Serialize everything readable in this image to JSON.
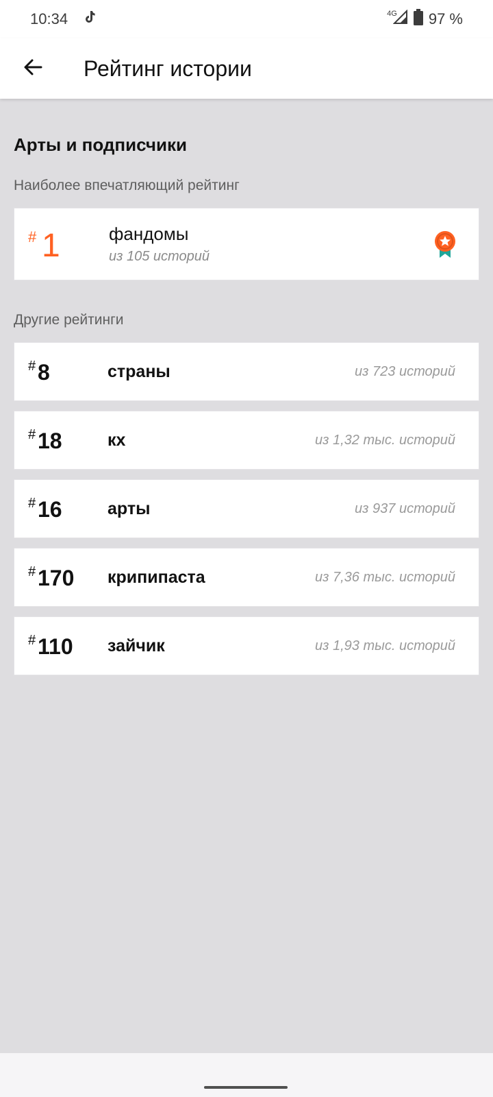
{
  "status_bar": {
    "time": "10:34",
    "network": "4G",
    "battery": "97 %",
    "icons": [
      "tiktok-icon",
      "signal-icon",
      "battery-icon"
    ]
  },
  "app_bar": {
    "title": "Рейтинг истории",
    "back_icon": "arrow-left-icon"
  },
  "section": {
    "title": "Арты и подписчики",
    "top_heading": "Наиболее впечатляющий рейтинг",
    "others_heading": "Другие рейтинги"
  },
  "top_rank": {
    "hash": "#",
    "rank": "1",
    "tag": "фандомы",
    "of": "из 105 историй",
    "badge_icon": "award-ribbon-icon"
  },
  "other_ranks": [
    {
      "hash": "#",
      "rank": "8",
      "tag": "страны",
      "of": "из 723 историй"
    },
    {
      "hash": "#",
      "rank": "18",
      "tag": "кх",
      "of": "из 1,32 тыс. историй"
    },
    {
      "hash": "#",
      "rank": "16",
      "tag": "арты",
      "of": "из 937 историй"
    },
    {
      "hash": "#",
      "rank": "170",
      "tag": "крипипаста",
      "of": "из 7,36 тыс. историй"
    },
    {
      "hash": "#",
      "rank": "110",
      "tag": "зайчик",
      "of": "из 1,93 тыс. историй"
    }
  ],
  "colors": {
    "accent": "#ff6122",
    "badge_ribbon": "#1fa69a",
    "background": "#dedde0"
  }
}
